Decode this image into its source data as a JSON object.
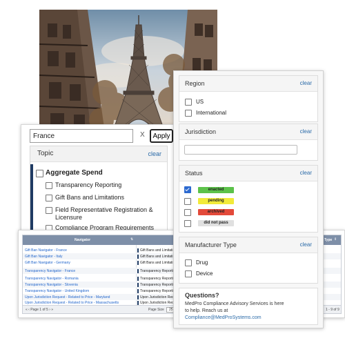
{
  "search": {
    "value": "France",
    "clear_x": "X",
    "apply_label": "Apply"
  },
  "topic": {
    "title": "Topic",
    "clear": "clear",
    "group": "Aggregate Spend",
    "items": [
      "Transparency Reporting",
      "Gift Bans and Limitations",
      "Field Representative Registration &",
      "Licensure",
      "Compliance Program Requirements"
    ]
  },
  "region": {
    "title": "Region",
    "clear": "clear",
    "options": [
      "US",
      "International"
    ]
  },
  "jurisdiction": {
    "title": "Jurisdiction",
    "clear": "clear"
  },
  "status": {
    "title": "Status",
    "clear": "clear",
    "options": [
      {
        "label": "enacted",
        "color": "#5cc24a",
        "checked": true
      },
      {
        "label": "pending",
        "color": "#f2ea3a",
        "checked": false
      },
      {
        "label": "archived",
        "color": "#e34a3a",
        "checked": false
      },
      {
        "label": "did not pass",
        "color": "#e0e0e0",
        "checked": false
      }
    ]
  },
  "manufacturer": {
    "title": "Manufacturer Type",
    "clear": "clear",
    "options": [
      "Drug",
      "Device"
    ]
  },
  "questions": {
    "title": "Questions?",
    "text1": "MedPro Compliance Advisory Services is here",
    "text2": "to help. Reach us at",
    "email": "Compliance@MedProSystems.com"
  },
  "table": {
    "header_nav": "Navigator",
    "header_type": "Type",
    "rows": [
      {
        "nav": "Gift Ban Navigator - France",
        "topic": "Gift Bans and Limitati"
      },
      {
        "nav": "Gift Ban Navigator - Italy",
        "topic": "Gift Bans and Limitati"
      },
      {
        "nav": "Gift Ban Navigator - Germany",
        "topic": "Gift Bans and Limitati"
      },
      {
        "nav": "Transparency Navigator - France",
        "topic": "Transparency Reportin"
      },
      {
        "nav": "Transparency Navigator - Romania",
        "topic": "Transparency Reportin"
      },
      {
        "nav": "Transparency Navigator - Slovenia",
        "topic": "Transparency Reportin"
      },
      {
        "nav": "Transparency Navigator - United Kingdom",
        "topic": "Transparency Reportin"
      },
      {
        "nav": "Upon Jurisdiction Request - Related to Price - Maryland",
        "topic": "Upon Jurisdiction Req"
      },
      {
        "nav": "Upon Jurisdiction Request - Related to Price - Massachusetts",
        "topic": "Upon Jurisdiction Req"
      }
    ],
    "pager": "« ‹  Page 1 of 5  › »",
    "page_size_label": "Page Size",
    "page_size": "25",
    "count": "1 - 9 of 9"
  },
  "colors": {
    "accent_blue": "#2a6aa8",
    "navy_bar": "#1f3b63",
    "table_header": "#7e8fa8"
  }
}
